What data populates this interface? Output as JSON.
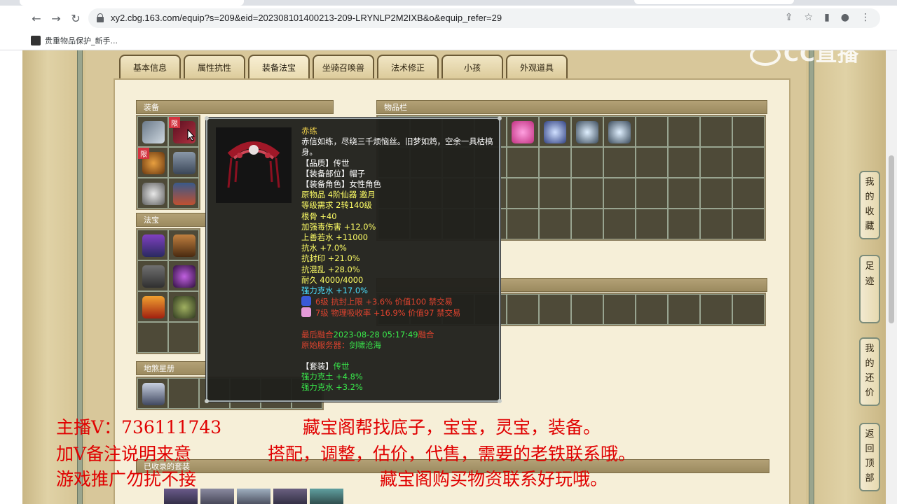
{
  "browser": {
    "url": "xy2.cbg.163.com/equip?s=209&eid=202308101400213-209-LRYNLP2M2IXB&o&equip_refer=29",
    "bookmark_label": "贵重物品保护_新手..."
  },
  "watermark": "CC直播",
  "tabs": [
    "基本信息",
    "属性抗性",
    "装备法宝",
    "坐骑召唤兽",
    "法术修正",
    "小孩",
    "外观道具"
  ],
  "active_tab": "装备法宝",
  "sections": {
    "equipment": "装备",
    "fabao": "法宝",
    "dishaxingce": "地煞星册",
    "items": "物品栏",
    "collected": "已收录的套装"
  },
  "limit_badge": "限",
  "tooltip": {
    "name": "赤练",
    "desc": "赤信如练，尽绕三千烦恼丝。旧梦如鸩，空余一具枯槁身。",
    "lines": [
      {
        "text": "【品质】传世",
        "color": "white"
      },
      {
        "text": "【装备部位】帽子",
        "color": "white"
      },
      {
        "text": "【装备角色】女性角色",
        "color": "white"
      },
      {
        "text": "原物品 4阶仙器 邀月",
        "color": "yellow"
      },
      {
        "text": "等级需求 2转140级",
        "color": "yellow"
      },
      {
        "text": "根骨 +40",
        "color": "yellow"
      },
      {
        "text": "加强毒伤害 +12.0%",
        "color": "yellow"
      },
      {
        "text": "上善若水 +11000",
        "color": "yellow"
      },
      {
        "text": "抗水 +7.0%",
        "color": "yellow"
      },
      {
        "text": "抗封印 +21.0%",
        "color": "yellow"
      },
      {
        "text": "抗混乱 +28.0%",
        "color": "yellow"
      },
      {
        "text": "耐久 4000/4000",
        "color": "yellow"
      },
      {
        "text": "强力克水 +17.0%",
        "color": "cyan"
      }
    ],
    "gems": [
      {
        "text": "6级 抗封上限 +3.6% 价值100 禁交易",
        "color": "#3a5ad8"
      },
      {
        "text": "7级 物理吸收率 +16.9% 价值97 禁交易",
        "color": "#e49ad8"
      }
    ],
    "time_prefix": "最后融合",
    "time": "2023-08-28 05:17:49",
    "time_suffix": "融合",
    "origin_label": "原始服务器：",
    "origin_value": "剑啸沧海",
    "suit_label": "【套装】",
    "suit_value": "传世",
    "suit_lines": [
      "强力克土 +4.8%",
      "强力克水 +3.2%"
    ]
  },
  "side_buttons": [
    {
      "label": "我的收藏"
    },
    {
      "label": "足迹"
    },
    {
      "label": "我的还价"
    },
    {
      "label": "返回顶部"
    }
  ],
  "overlay": {
    "line1_left": "主播V：736111743",
    "line1_right": "藏宝阁帮找底子，宝宝，灵宝，装备。",
    "line2_left": "加V备注说明来意",
    "line2_right": "搭配，调整，估价，代售，需要的老铁联系哦。",
    "line3_left": "游戏推广勿扰不接",
    "line3_right": "藏宝阁购买物资联系好玩哦。"
  }
}
